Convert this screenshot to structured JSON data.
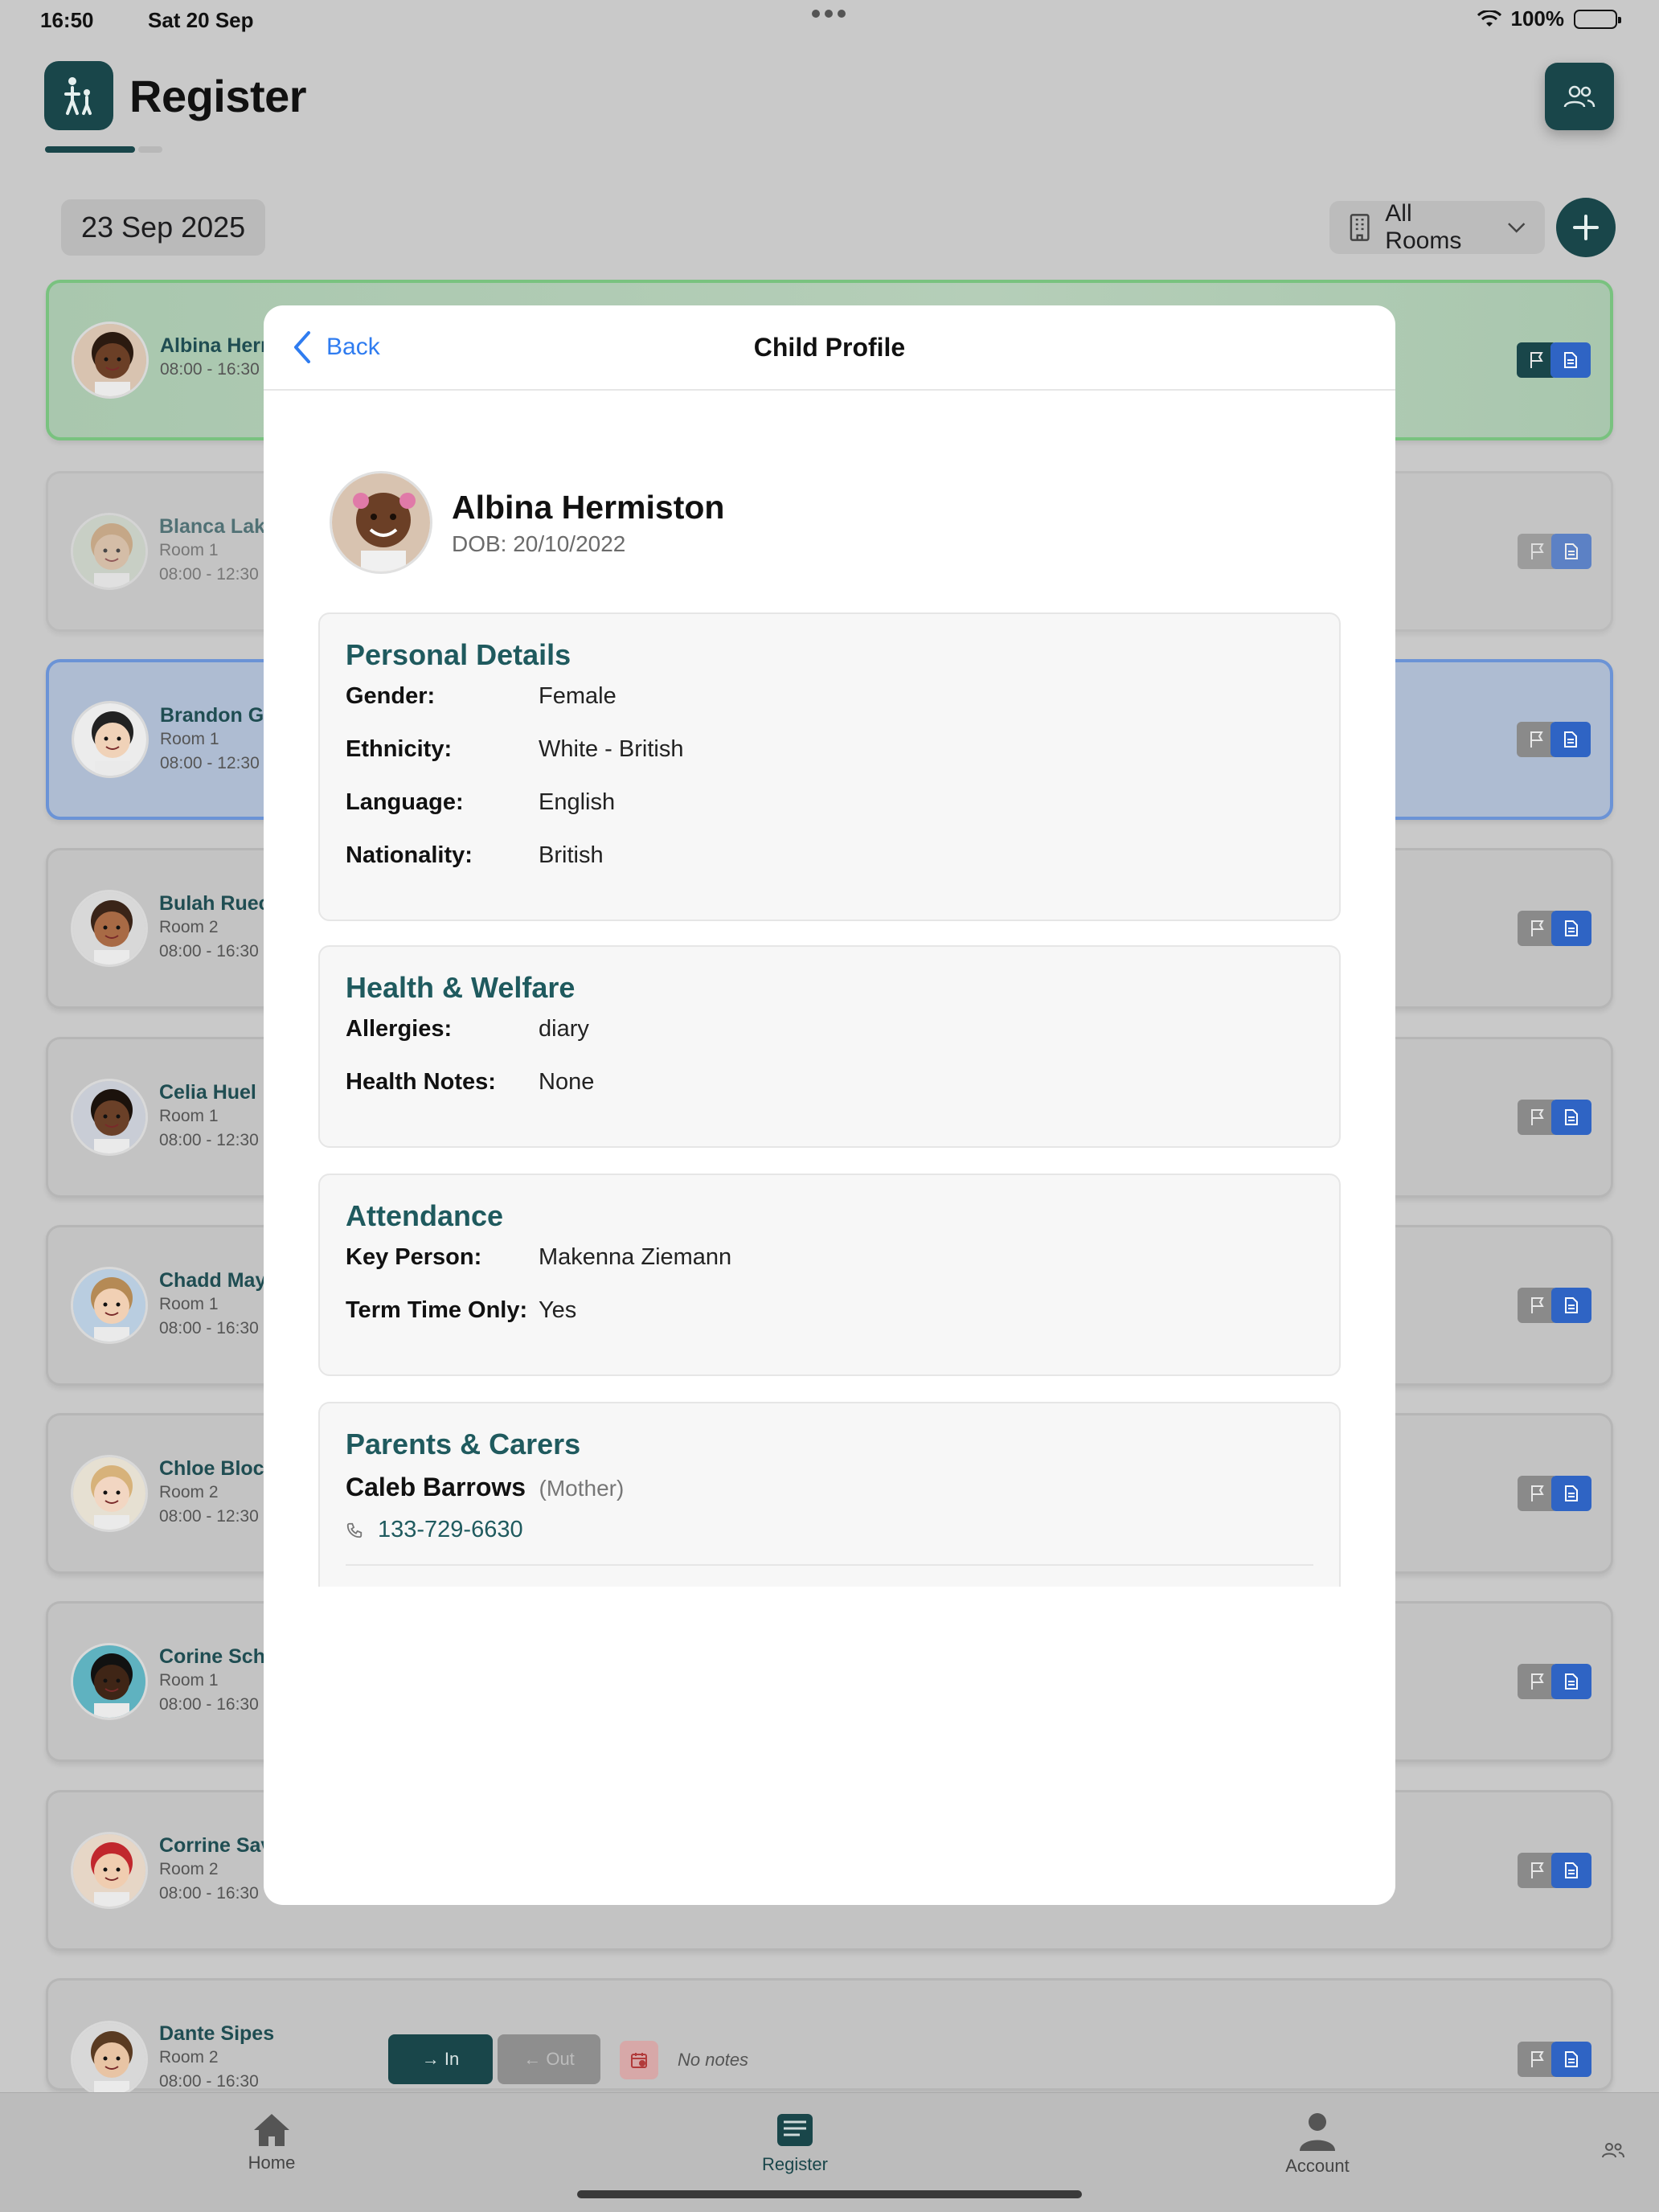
{
  "status_bar": {
    "time": "16:50",
    "date": "Sat 20 Sep",
    "battery": "100%"
  },
  "header": {
    "title": "Register"
  },
  "toolbar": {
    "date": "23 Sep 2025",
    "rooms_label": "All Rooms"
  },
  "children": [
    {
      "name": "Albina Herr",
      "room": "",
      "time": "08:00 - 16:30",
      "state": "green"
    },
    {
      "name": "Blanca Lak",
      "room": "Room 1",
      "time": "08:00 - 12:30",
      "state": "faded"
    },
    {
      "name": "Brandon Gi",
      "room": "Room 1",
      "time": "08:00 - 12:30",
      "state": "blue"
    },
    {
      "name": "Bulah Ruec",
      "room": "Room 2",
      "time": "08:00 - 16:30",
      "state": "normal"
    },
    {
      "name": "Celia Huel",
      "room": "Room 1",
      "time": "08:00 - 12:30",
      "state": "normal"
    },
    {
      "name": "Chadd May",
      "room": "Room 1",
      "time": "08:00 - 16:30",
      "state": "normal"
    },
    {
      "name": "Chloe Block",
      "room": "Room 2",
      "time": "08:00 - 12:30",
      "state": "normal"
    },
    {
      "name": "Corine Sch",
      "room": "Room 1",
      "time": "08:00 - 16:30",
      "state": "normal"
    },
    {
      "name": "Corrine Sav",
      "room": "Room 2",
      "time": "08:00 - 16:30",
      "state": "normal"
    },
    {
      "name": "Dante Sipes",
      "room": "Room 2",
      "time": "08:00 - 16:30",
      "state": "normal"
    }
  ],
  "last_row_actions": {
    "in_label": "In",
    "out_label": "Out",
    "notes": "No notes"
  },
  "tabbar": {
    "home": "Home",
    "register": "Register",
    "account": "Account"
  },
  "modal": {
    "back_label": "Back",
    "title": "Child Profile",
    "child_name": "Albina Hermiston",
    "dob": "DOB: 20/10/2022",
    "personal_details": {
      "heading": "Personal Details",
      "rows": [
        {
          "label": "Gender:",
          "value": "Female"
        },
        {
          "label": "Ethnicity:",
          "value": "White - British"
        },
        {
          "label": "Language:",
          "value": "English"
        },
        {
          "label": "Nationality:",
          "value": "British"
        }
      ]
    },
    "health": {
      "heading": "Health & Welfare",
      "rows": [
        {
          "label": "Allergies:",
          "value": "diary"
        },
        {
          "label": "Health Notes:",
          "value": "None"
        }
      ]
    },
    "attendance": {
      "heading": "Attendance",
      "rows": [
        {
          "label": "Key Person:",
          "value": "Makenna Ziemann"
        },
        {
          "label": "Term Time Only:",
          "value": "Yes"
        }
      ]
    },
    "parents": {
      "heading": "Parents & Carers",
      "name": "Caleb Barrows",
      "relation": "(Mother)",
      "phone": "133-729-6630"
    }
  }
}
